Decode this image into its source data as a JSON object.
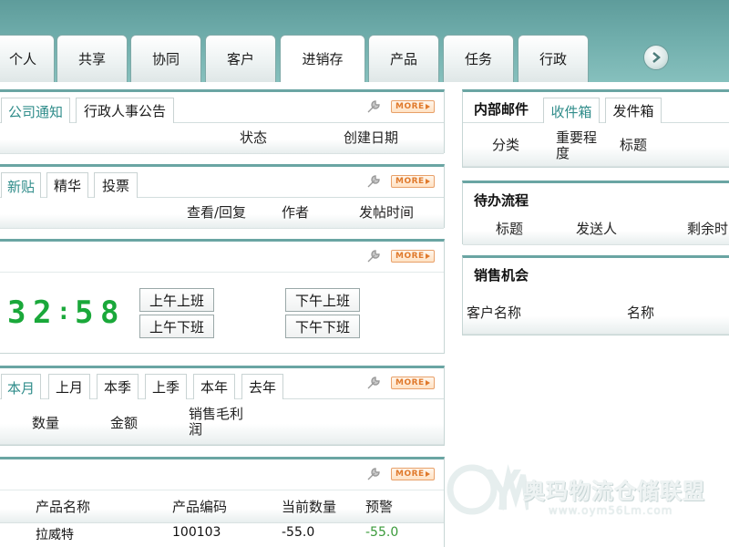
{
  "nav": {
    "tabs": [
      {
        "label": "个人"
      },
      {
        "label": "共享"
      },
      {
        "label": "协同"
      },
      {
        "label": "客户"
      },
      {
        "label": "进销存"
      },
      {
        "label": "产品"
      },
      {
        "label": "任务"
      },
      {
        "label": "行政"
      }
    ],
    "active_index": 4
  },
  "notice": {
    "tabs": [
      "公司通知",
      "行政人事公告"
    ],
    "more_label": "MORE",
    "columns": [
      "状态",
      "创建日期"
    ]
  },
  "forum": {
    "tabs": [
      "新贴",
      "精华",
      "投票"
    ],
    "more_label": "MORE",
    "columns": [
      "查看/回复",
      "作者",
      "发帖时间"
    ]
  },
  "attendance": {
    "more_label": "MORE",
    "clock": [
      "3",
      "2",
      ":",
      "5",
      "8"
    ],
    "buttons": [
      "上午上班",
      "上午下班",
      "下午上班",
      "下午下班"
    ]
  },
  "sales_stats": {
    "tabs": [
      "本月",
      "上月",
      "本季",
      "上季",
      "本年",
      "去年"
    ],
    "more_label": "MORE",
    "columns": [
      "数量",
      "金额",
      "销售毛利润"
    ]
  },
  "inventory": {
    "more_label": "MORE",
    "columns": [
      "产品名称",
      "产品编码",
      "当前数量",
      "预警"
    ],
    "rows": [
      {
        "name": "拉威特",
        "code": "100103",
        "qty": "-55.0",
        "warn": "-55.0"
      }
    ]
  },
  "mail": {
    "title": "内部邮件",
    "tabs": [
      "收件箱",
      "发件箱"
    ],
    "columns": [
      "分类",
      "重要程度",
      "标题"
    ]
  },
  "workflow": {
    "title": "待办流程",
    "columns": [
      "标题",
      "发送人",
      "剩余时"
    ]
  },
  "opportunity": {
    "title": "销售机会",
    "columns": [
      "客户名称",
      "名称"
    ]
  },
  "watermark": {
    "brand": "奥玛物流仓储联盟",
    "url": "www.oym56Lm.com"
  }
}
